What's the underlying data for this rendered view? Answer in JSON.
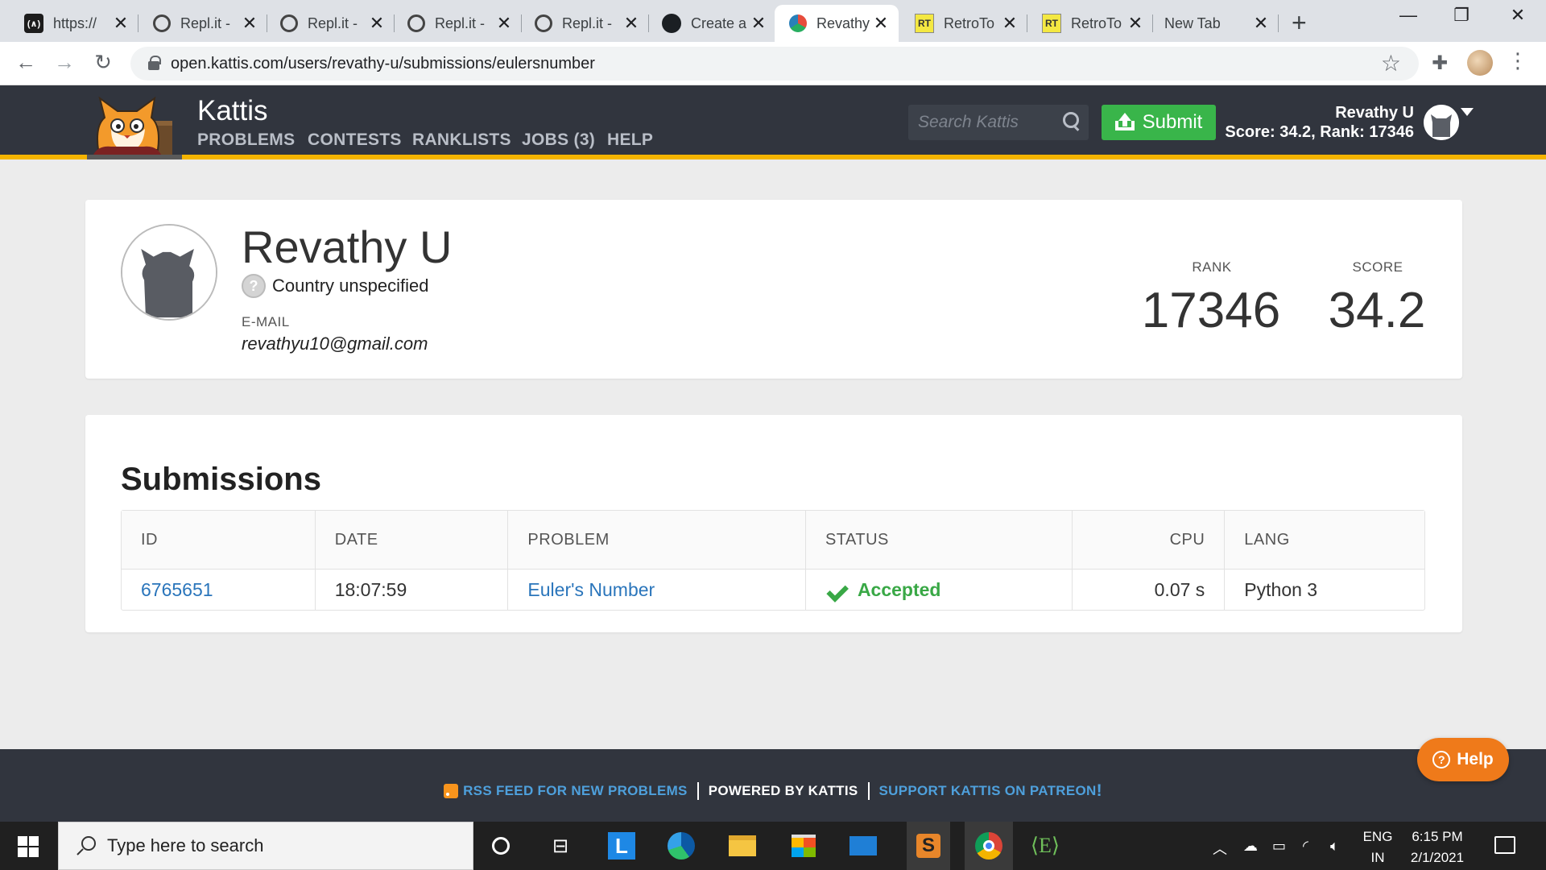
{
  "browser": {
    "tabs": [
      {
        "title": "https://",
        "icon": "replit-dark-icon"
      },
      {
        "title": "Repl.it -",
        "icon": "replit-icon"
      },
      {
        "title": "Repl.it -",
        "icon": "replit-icon"
      },
      {
        "title": "Repl.it -",
        "icon": "replit-icon"
      },
      {
        "title": "Repl.it -",
        "icon": "replit-icon"
      },
      {
        "title": "Create a",
        "icon": "github-icon"
      },
      {
        "title": "Revathy",
        "icon": "kattis-icon"
      },
      {
        "title": "RetroTo",
        "icon": "retrotool-icon"
      },
      {
        "title": "RetroTo",
        "icon": "retrotool-icon"
      },
      {
        "title": "New Tab",
        "icon": ""
      }
    ],
    "active_tab_index": 6,
    "url": "open.kattis.com/users/revathy-u/submissions/eulersnumber"
  },
  "header": {
    "brand": "Kattis",
    "nav": [
      "PROBLEMS",
      "CONTESTS",
      "RANKLISTS",
      "JOBS (3)",
      "HELP"
    ],
    "search_placeholder": "Search Kattis",
    "submit_label": "Submit",
    "user_name": "Revathy U",
    "user_stats": "Score: 34.2, Rank: 17346"
  },
  "profile": {
    "name": "Revathy U",
    "country": "Country unspecified",
    "email_label": "E-MAIL",
    "email": "revathyu10@gmail.com",
    "rank_label": "RANK",
    "rank": "17346",
    "score_label": "SCORE",
    "score": "34.2"
  },
  "submissions": {
    "title": "Submissions",
    "columns": [
      "ID",
      "DATE",
      "PROBLEM",
      "STATUS",
      "CPU",
      "LANG"
    ],
    "rows": [
      {
        "id": "6765651",
        "date": "18:07:59",
        "problem": "Euler's Number",
        "status": "Accepted",
        "cpu": "0.07 s",
        "lang": "Python 3"
      }
    ]
  },
  "footer": {
    "rss": "RSS FEED FOR NEW PROBLEMS",
    "powered": "POWERED BY KATTIS",
    "support": "SUPPORT KATTIS ON PATREON",
    "support_mark": "!",
    "help": "Help"
  },
  "taskbar": {
    "search_placeholder": "Type here to search",
    "lang_line1": "ENG",
    "lang_line2": "IN",
    "time": "6:15 PM",
    "date": "2/1/2021"
  },
  "colors": {
    "kattis_dark": "#31353e",
    "kattis_accent": "#f4b400",
    "submit_green": "#39b54a",
    "link_blue": "#2a75bb",
    "accepted_green": "#39a846",
    "help_orange": "#ef7a1a"
  }
}
